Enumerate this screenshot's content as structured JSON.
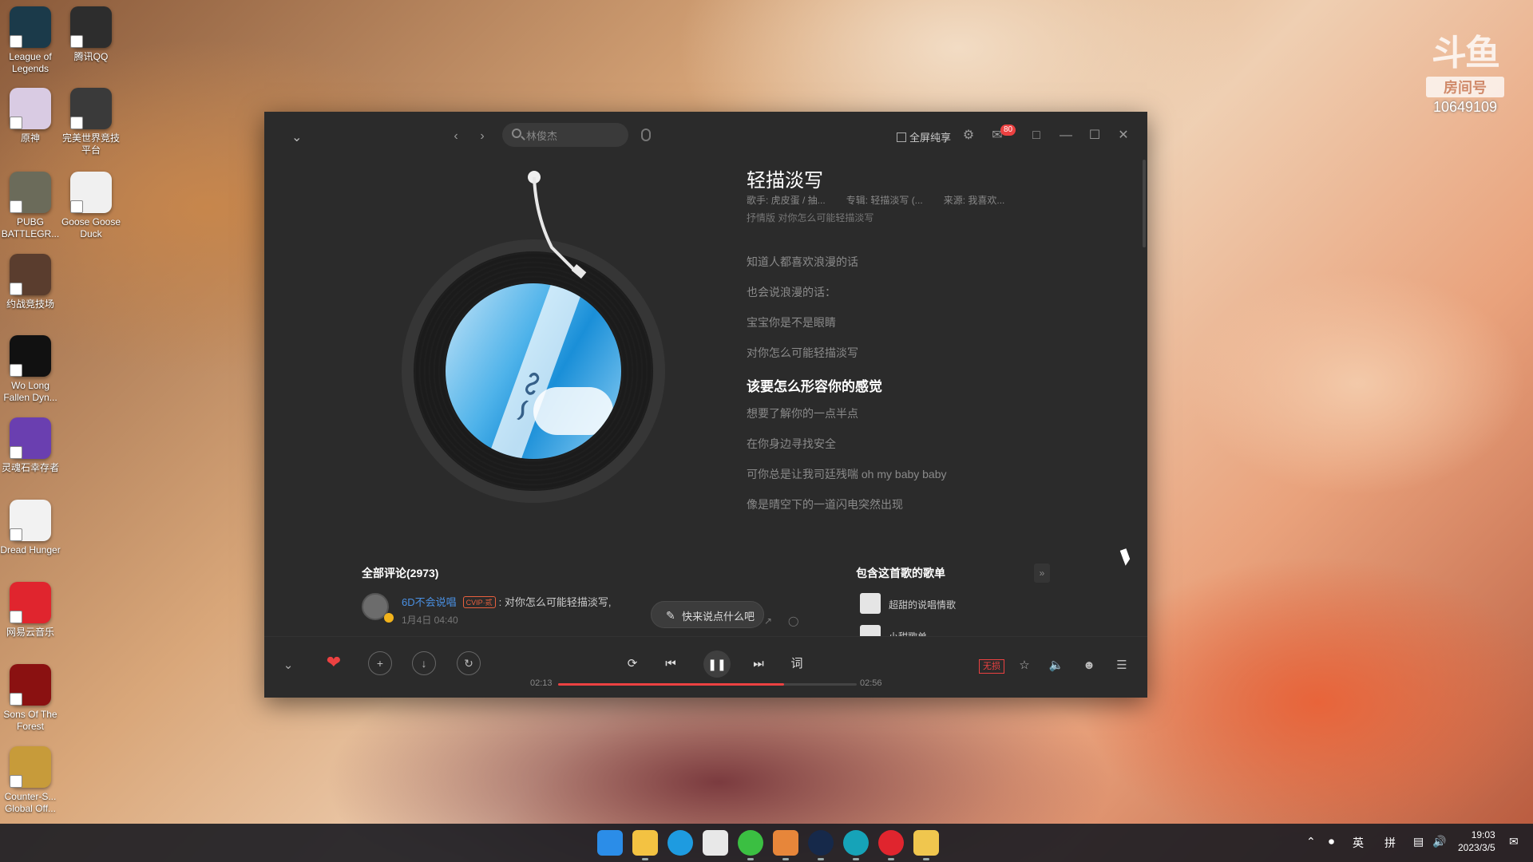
{
  "desktop": {
    "icons": [
      {
        "label": "League of Legends",
        "icon": "league-of-legends-icon",
        "color": "#1b3a4a"
      },
      {
        "label": "腾讯QQ",
        "icon": "qq-penguin-icon",
        "color": "#2d2d2d"
      },
      {
        "label": "原神",
        "icon": "genshin-icon",
        "color": "#d9cbe3"
      },
      {
        "label": "完美世界竞技平台",
        "icon": "perfect-world-icon",
        "color": "#3a3a3a"
      },
      {
        "label": "PUBG BATTLEGR...",
        "icon": "pubg-icon",
        "color": "#6b6b5a"
      },
      {
        "label": "Goose Goose Duck",
        "icon": "goose-icon",
        "color": "#f0f0f0"
      },
      {
        "label": "约战竞技场",
        "icon": "yuezhan-icon",
        "color": "#5a3d2e"
      },
      {
        "label": "Wo Long Fallen Dyn...",
        "icon": "wo-long-icon",
        "color": "#111111"
      },
      {
        "label": "灵魂石幸存者",
        "icon": "soulstone-icon",
        "color": "#6a3fb0"
      },
      {
        "label": "Dread Hunger",
        "icon": "dread-hunger-icon",
        "color": "#f2f2f2"
      },
      {
        "label": "网易云音乐",
        "icon": "netease-music-icon",
        "color": "#e0252e"
      },
      {
        "label": "Sons Of The Forest",
        "icon": "sons-of-forest-icon",
        "color": "#8a1111"
      },
      {
        "label": "Counter-S... Global Off...",
        "icon": "csgo-icon",
        "color": "#c79b3a"
      }
    ]
  },
  "watermark": {
    "logo": "斗鱼",
    "room_label": "房间号",
    "room_number": "10649109"
  },
  "app": {
    "search_placeholder": "林俊杰",
    "share_label": "全屏纯享",
    "mail_badge": "80",
    "song": {
      "title": "轻描淡写",
      "singer": "歌手: 虎皮蛋 / 抽...",
      "album": "专辑: 轻描淡写 (...",
      "source": "来源: 我喜欢...",
      "sub_line": "抒情版 对你怎么可能轻描淡写"
    },
    "lyrics": [
      {
        "text": "知道人都喜欢浪漫的话",
        "active": false
      },
      {
        "text": "也会说浪漫的话：",
        "active": false
      },
      {
        "text": "宝宝你是不是眼睛",
        "active": false
      },
      {
        "text": "对你怎么可能轻描淡写",
        "active": false
      },
      {
        "text": "该要怎么形容你的感觉",
        "active": true
      },
      {
        "text": "想要了解你的一点半点",
        "active": false
      },
      {
        "text": "在你身边寻找安全",
        "active": false
      },
      {
        "text": "可你总是让我司廷残喘 oh my baby baby",
        "active": false
      },
      {
        "text": "像是晴空下的一道闪电突然出现",
        "active": false
      }
    ],
    "comments": {
      "title": "全部评论(2973)",
      "user": "6D不会说唱",
      "badge": "CVIP·贰",
      "text": "对你怎么可能轻描淡写,",
      "time": "1月4日 04:40",
      "say_button": "快来说点什么吧"
    },
    "playlists": {
      "title": "包含这首歌的歌单",
      "items": [
        "超甜的说唱情歌",
        "小甜歌单"
      ]
    },
    "player": {
      "current_time": "02:13",
      "total_time": "02:56",
      "progress": 0.757,
      "quality_label": "无损",
      "lyrics_button": "词"
    }
  },
  "taskbar": {
    "ime_lang": "英",
    "ime_mode": "拼",
    "time": "19:03",
    "date": "2023/3/5"
  },
  "colors": {
    "accent": "#ec4141",
    "window_bg": "#2b2b2b"
  }
}
